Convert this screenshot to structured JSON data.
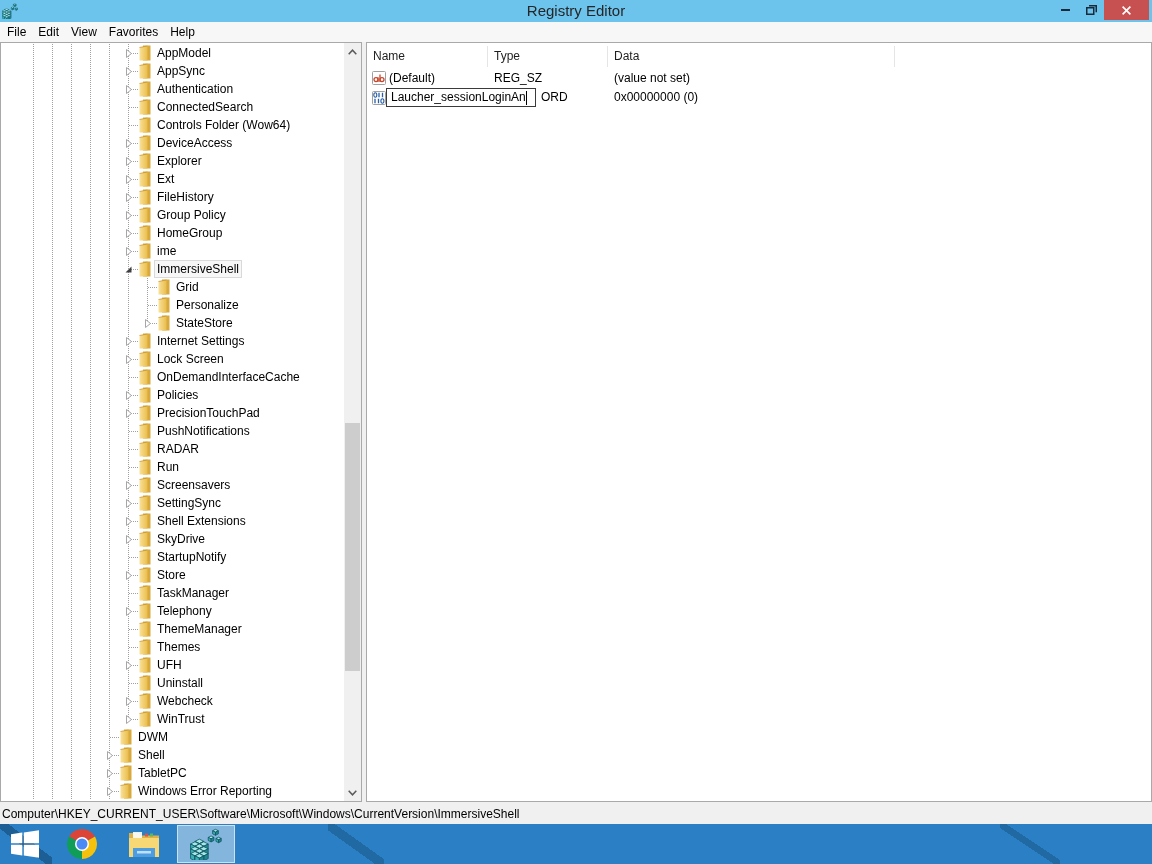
{
  "window": {
    "title": "Registry Editor"
  },
  "menu": [
    "File",
    "Edit",
    "View",
    "Favorites",
    "Help"
  ],
  "tree": {
    "items": [
      {
        "children": [
          {
            "label": "AppModel",
            "expanded": false,
            "selected": false
          },
          {
            "label": "AppSync",
            "expanded": false,
            "selected": false
          },
          {
            "label": "Authentication",
            "expanded": false,
            "selected": false
          },
          {
            "label": "ConnectedSearch",
            "selected": false
          },
          {
            "label": "Controls Folder (Wow64)",
            "selected": false
          },
          {
            "label": "DeviceAccess",
            "expanded": false,
            "selected": false
          },
          {
            "label": "Explorer",
            "expanded": false,
            "selected": false
          },
          {
            "label": "Ext",
            "expanded": false,
            "selected": false
          },
          {
            "label": "FileHistory",
            "expanded": false,
            "selected": false
          },
          {
            "label": "Group Policy",
            "expanded": false,
            "selected": false
          },
          {
            "label": "HomeGroup",
            "expanded": false,
            "selected": false
          },
          {
            "label": "ime",
            "expanded": false,
            "selected": false
          },
          {
            "label": "ImmersiveShell",
            "expanded": true,
            "selected": true,
            "children": [
              {
                "label": "Grid",
                "selected": false
              },
              {
                "label": "Personalize",
                "selected": false
              },
              {
                "label": "StateStore",
                "expanded": false,
                "selected": false
              }
            ]
          },
          {
            "label": "Internet Settings",
            "expanded": false,
            "selected": false
          },
          {
            "label": "Lock Screen",
            "expanded": false,
            "selected": false
          },
          {
            "label": "OnDemandInterfaceCache",
            "selected": false
          },
          {
            "label": "Policies",
            "expanded": false,
            "selected": false
          },
          {
            "label": "PrecisionTouchPad",
            "expanded": false,
            "selected": false
          },
          {
            "label": "PushNotifications",
            "selected": false
          },
          {
            "label": "RADAR",
            "selected": false
          },
          {
            "label": "Run",
            "selected": false
          },
          {
            "label": "Screensavers",
            "expanded": false,
            "selected": false
          },
          {
            "label": "SettingSync",
            "expanded": false,
            "selected": false
          },
          {
            "label": "Shell Extensions",
            "expanded": false,
            "selected": false
          },
          {
            "label": "SkyDrive",
            "expanded": false,
            "selected": false
          },
          {
            "label": "StartupNotify",
            "selected": false
          },
          {
            "label": "Store",
            "expanded": false,
            "selected": false
          },
          {
            "label": "TaskManager",
            "selected": false
          },
          {
            "label": "Telephony",
            "expanded": false,
            "selected": false
          },
          {
            "label": "ThemeManager",
            "selected": false
          },
          {
            "label": "Themes",
            "selected": false
          },
          {
            "label": "UFH",
            "expanded": false,
            "selected": false
          },
          {
            "label": "Uninstall",
            "selected": false
          },
          {
            "label": "Webcheck",
            "expanded": false,
            "selected": false
          },
          {
            "label": "WinTrust",
            "expanded": false,
            "selected": false
          }
        ]
      },
      {
        "label": "DWM",
        "selected": false
      },
      {
        "label": "Shell",
        "expanded": false,
        "selected": false
      },
      {
        "label": "TabletPC",
        "expanded": false,
        "selected": false
      },
      {
        "label": "Windows Error Reporting",
        "expanded": false,
        "selected": false
      }
    ]
  },
  "values": {
    "columns": [
      "Name",
      "Type",
      "Data"
    ],
    "rows": [
      {
        "kind": "string",
        "name": "(Default)",
        "editing": false,
        "type": "REG_SZ",
        "data": "(value not set)"
      },
      {
        "kind": "binary",
        "name": "Laucher_sessionLoginAn",
        "editing": true,
        "type": "ORD",
        "data": "0x00000000 (0)"
      }
    ]
  },
  "status_bar": {
    "path": "Computer\\HKEY_CURRENT_USER\\Software\\Microsoft\\Windows\\CurrentVersion\\ImmersiveShell"
  },
  "taskbar": {
    "items": [
      {
        "kind": "start",
        "active": false
      },
      {
        "kind": "browser",
        "active": false
      },
      {
        "kind": "explorer",
        "active": false
      },
      {
        "kind": "registry",
        "active": true
      }
    ]
  }
}
